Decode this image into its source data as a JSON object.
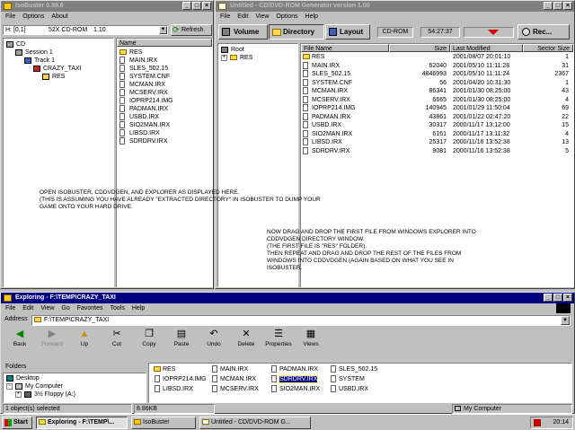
{
  "isobuster": {
    "title": "IsoBuster 0.99.6",
    "menu": [
      "File",
      "Options",
      "About"
    ],
    "address": "H: [0,1]",
    "drive": "52X CD-ROM",
    "drive_ver": "1.10",
    "refresh": "Refresh",
    "tree": [
      {
        "label": "CD",
        "indent": 0
      },
      {
        "label": "Session 1",
        "indent": 1
      },
      {
        "label": "Track 1",
        "indent": 2
      },
      {
        "label": "CRAZY_TAXI",
        "indent": 3
      },
      {
        "label": "RES",
        "indent": 4
      }
    ],
    "list_header": "Name",
    "files": [
      "RES",
      "MAIN.IRX",
      "SLES_502.15",
      "SYSTEM.CNF",
      "MCMAN.IRX",
      "MCSERV.IRX",
      "IOPRP214.IMG",
      "PADMAN.IRX",
      "USBD.IRX",
      "SIO2MAN.IRX",
      "LIBSD.IRX",
      "SDRDRV.IRX"
    ]
  },
  "cddvdgen": {
    "title": "Untitled - CD/DVD-ROM Generator version 1.00",
    "menu": [
      "File",
      "Edit",
      "View",
      "Options",
      "Help"
    ],
    "volume": "Volume",
    "directory": "Directory",
    "layout": "Layout",
    "media": "CD-ROM",
    "time": "54:27:37",
    "rec": "Rec...",
    "tree_root": "Root",
    "tree_child": "RES",
    "headers": {
      "name": "File Name",
      "size": "Size",
      "modified": "Last Modified",
      "sector": "Sector Size"
    },
    "rows": [
      {
        "name": "RES",
        "size": "",
        "date": "2001/08/07 20:01:10",
        "sector": "1"
      },
      {
        "name": "MAIN.IRX",
        "size": "62040",
        "date": "2001/05/10 11:11:28",
        "sector": "31"
      },
      {
        "name": "SLES_502.15",
        "size": "4846993",
        "date": "2001/05/10 11:11:24",
        "sector": "2367"
      },
      {
        "name": "SYSTEM.CNF",
        "size": "56",
        "date": "2001/04/20 10:31:30",
        "sector": "1"
      },
      {
        "name": "MCMAN.IRX",
        "size": "86341",
        "date": "2001/01/30 08:25:00",
        "sector": "43"
      },
      {
        "name": "MCSERV.IRX",
        "size": "6665",
        "date": "2001/01/30 08:25:00",
        "sector": "4"
      },
      {
        "name": "IOPRP214.IMG",
        "size": "140945",
        "date": "2001/01/29 11:50:04",
        "sector": "69"
      },
      {
        "name": "PADMAN.IRX",
        "size": "43861",
        "date": "2001/01/22 02:47:20",
        "sector": "22"
      },
      {
        "name": "USBD.IRX",
        "size": "30317",
        "date": "2000/11/17 13:12:00",
        "sector": "15"
      },
      {
        "name": "SIO2MAN.IRX",
        "size": "6161",
        "date": "2000/11/17 13:11:32",
        "sector": "4"
      },
      {
        "name": "LIBSD.IRX",
        "size": "25317",
        "date": "2000/11/16 13:52:38",
        "sector": "13"
      },
      {
        "name": "SDRDRV.IRX",
        "size": "9081",
        "date": "2000/11/16 13:52:38",
        "sector": "5"
      }
    ]
  },
  "notes": {
    "left": "OPEN ISOBUSTER, CDDVDGEN, AND EXPLORER AS DISPLAYED HERE.\n(THIS IS ASSUMING YOU HAVE ALREADY \"EXTRACTED DIRECTORY\" IN ISOBUSTER TO DUMP YOUR\nGAME ONTO YOUR HARD DRIVE.",
    "right": "NOW DRAG AND DROP THE FIRST FILE FROM WINDOWS EXPLORER INTO\nCDDVDGEN DIRECTORY WINDOW.\n(THE FIRST FILE IS \"RES\" FOLDER).\nTHEN REPEAT AND DRAG AND DROP THE REST OF THE FILES FROM\nWINDOWS INTO CDDVDGEN (AGAIN BASED ON WHAT YOU SEE IN\nISOBUSTER."
  },
  "explorer": {
    "title": "Exploring - F:\\TEMP\\CRAZY_TAXI",
    "menu": [
      "File",
      "Edit",
      "View",
      "Go",
      "Favorites",
      "Tools",
      "Help"
    ],
    "address_label": "Address",
    "address": "F:\\TEMP\\CRAZY_TAXI",
    "toolbar": [
      "Back",
      "Forward",
      "Up",
      "Cut",
      "Copy",
      "Paste",
      "Undo",
      "Delete",
      "Properties",
      "Views"
    ],
    "folders_header": "Folders",
    "folders": [
      "Desktop",
      "My Computer",
      "3½ Floppy (A:)"
    ],
    "items": [
      [
        "RES",
        "MAIN.IRX",
        "PADMAN.IRX",
        "SLES_502.15"
      ],
      [
        "IOPRP214.IMG",
        "MCMAN.IRX",
        "SDRDRV.IRX",
        "SYSTEM"
      ],
      [
        "LIBSD.IRX",
        "MCSERV.IRX",
        "SIO2MAN.IRX",
        "USBD.IRX"
      ]
    ],
    "status_left": "1 object(s) selected",
    "status_size": "8.86KB",
    "status_right": "My Computer"
  },
  "taskbar": {
    "start": "Start",
    "tasks": [
      "Exploring - F:\\TEMP\\...",
      "IsoBuster",
      "Untitled - CD/DVD-ROM G..."
    ],
    "clock": "20:14"
  }
}
